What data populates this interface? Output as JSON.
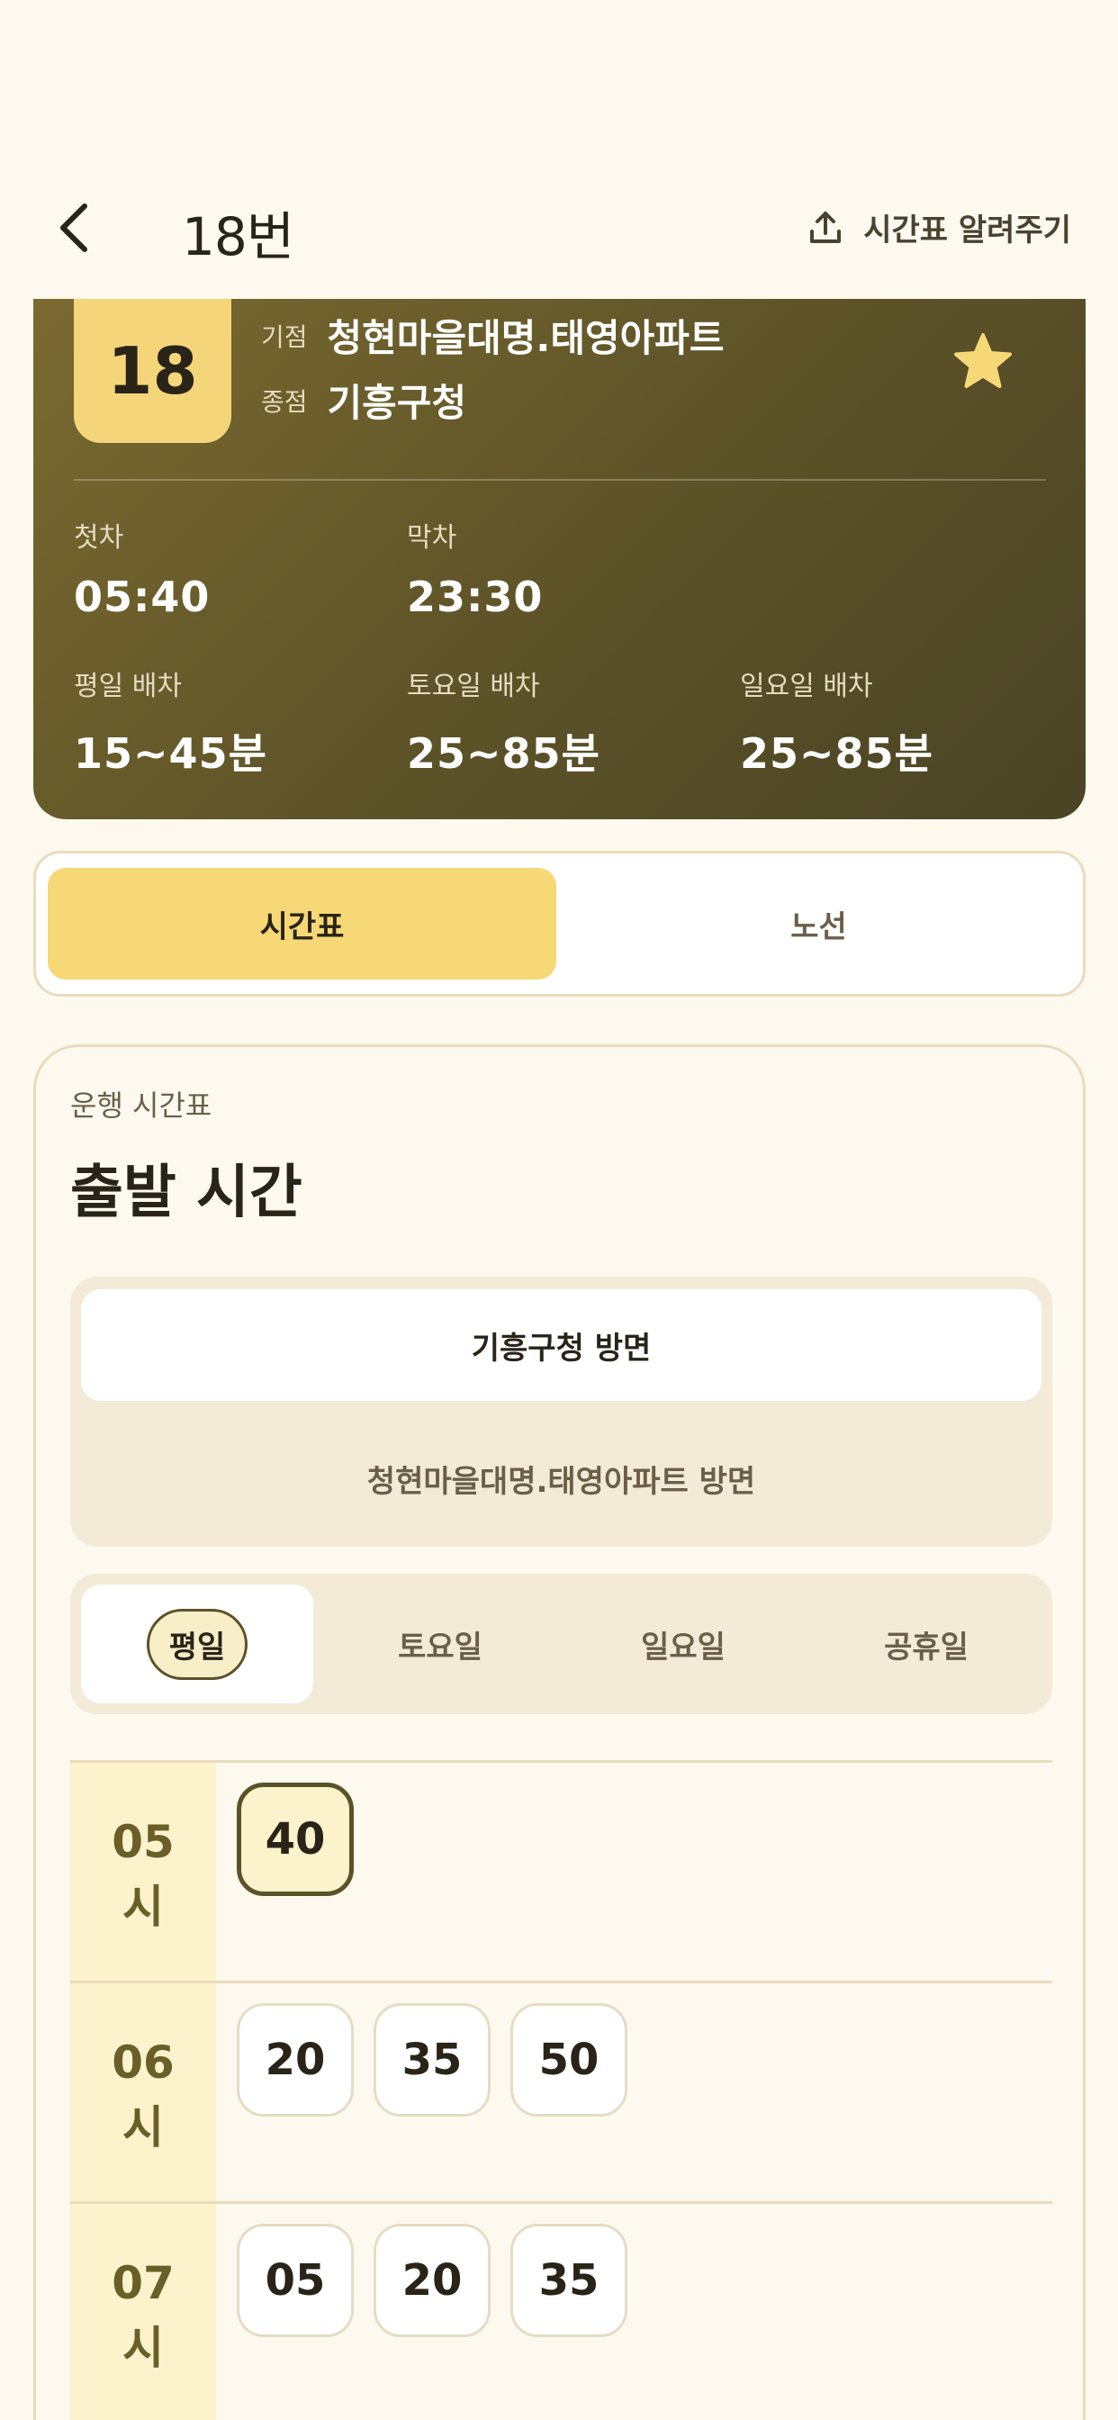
{
  "header": {
    "title": "18번",
    "share_label": "시간표 알려주기"
  },
  "route": {
    "number": "18",
    "origin_label": "기점",
    "origin": "청현마을대명.태영아파트",
    "terminal_label": "종점",
    "terminal": "기흥구청",
    "first_label": "첫차",
    "first": "05:40",
    "last_label": "막차",
    "last": "23:30",
    "weekday_label": "평일 배차",
    "weekday": "15~45분",
    "saturday_label": "토요일 배차",
    "saturday": "25~85분",
    "sunday_label": "일요일 배차",
    "sunday": "25~85분",
    "favorite": true
  },
  "segment_tabs": [
    "시간표",
    "노선"
  ],
  "timetable": {
    "subtitle": "운행 시간표",
    "title": "출발 시간",
    "directions": [
      "기흥구청 방면",
      "청현마을대명.태영아파트 방면"
    ],
    "day_tabs": [
      "평일",
      "토요일",
      "일요일",
      "공휴일"
    ],
    "rows": [
      {
        "hour": "05",
        "unit": "시",
        "minutes": [
          "40"
        ]
      },
      {
        "hour": "06",
        "unit": "시",
        "minutes": [
          "20",
          "35",
          "50"
        ]
      },
      {
        "hour": "07",
        "unit": "시",
        "minutes": [
          "05",
          "20",
          "35"
        ]
      }
    ]
  },
  "colors": {
    "accent": "#f6d877",
    "hero_dark": "#5c5228",
    "background": "#fdf9ee"
  }
}
